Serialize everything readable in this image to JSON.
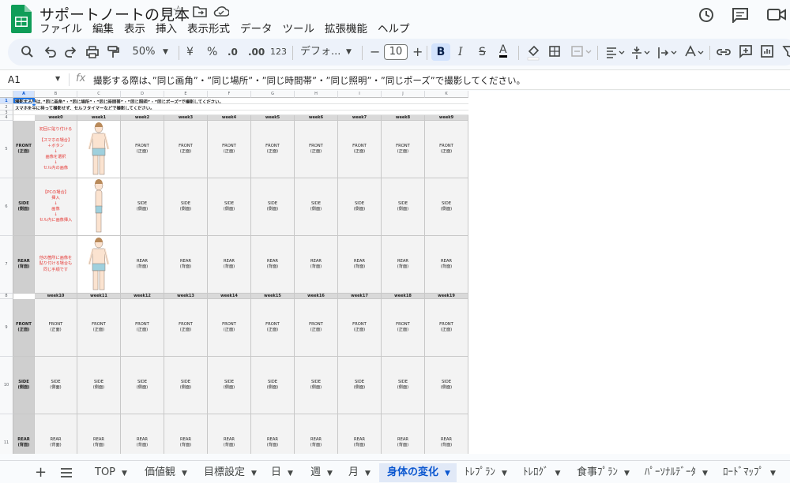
{
  "app": {
    "doc_title": "サポートノートの見本",
    "name_box": "A1",
    "formula": "撮影する際は、”同じ画角”・”同じ場所”・”同じ時間帯”・”同じ照明”・”同じポーズ”で撮影してください。"
  },
  "menu": [
    "ファイル",
    "編集",
    "表示",
    "挿入",
    "表示形式",
    "データ",
    "ツール",
    "拡張機能",
    "ヘルプ"
  ],
  "toolbar": {
    "zoom": "50%",
    "currency": "¥",
    "percent": "%",
    "dec_less": ".0",
    "dec_more": ".00",
    "format_123": "123",
    "font": "デフォ...",
    "font_size": "10",
    "minus": "−",
    "plus": "+",
    "bold": "B",
    "italic": "I",
    "strike": "S",
    "textcolor": "A"
  },
  "columns": [
    "A",
    "B",
    "C",
    "D",
    "E",
    "F",
    "G",
    "H",
    "I",
    "J",
    "K"
  ],
  "rows": {
    "r1": "1",
    "r2": "2",
    "r3": "3",
    "r4": "4",
    "r5": "5",
    "r6": "6",
    "r7": "7",
    "r8": "8",
    "r9": "9",
    "r10": "10",
    "r11": "11"
  },
  "notes": {
    "line1": "撮影する際は、”同じ画角”・”同じ場所”・”同じ時間帯”・”同じ照明”・”同じポーズ”で撮影してください。",
    "line2": "スマホを手に持って撮影せず、セルフタイマーなどで撮影してください。"
  },
  "weeks_top": [
    "week0",
    "week1",
    "week2",
    "week3",
    "week4",
    "week5",
    "week6",
    "week7",
    "week8",
    "week9"
  ],
  "weeks_bottom": [
    "week10",
    "week11",
    "week12",
    "week13",
    "week14",
    "week15",
    "week16",
    "week17",
    "week18",
    "week19"
  ],
  "row_labels": {
    "front": "FRONT\n(正面)",
    "side": "SIDE\n(側面)",
    "rear": "REAR\n(背面)"
  },
  "instructions": {
    "front": "初回に貼り付ける\n\n【スマホの場合】\n＋ボタン\n↓\n画像を選択\n↓\nセル内の画像",
    "side": "【PCの場合】\n挿入\n↓\n画像\n↓\nセル内に画像挿入",
    "rear": "他の箇所に画像を\n貼り付ける場合も\n同じ手順です"
  },
  "placeholders": {
    "front": "FRONT\n(正面)",
    "side": "SIDE\n(側面)",
    "rear": "REAR\n(背面)"
  },
  "tabs": [
    "TOP",
    "価値観",
    "目標設定",
    "日",
    "週",
    "月",
    "身体の変化",
    "ﾄﾚﾌﾟﾗﾝ",
    "ﾄﾚﾛｸﾞ",
    "食事ﾌﾟﾗﾝ",
    "ﾊﾟｰｿﾅﾙﾃﾞｰﾀ",
    "ﾛｰﾄﾞﾏｯﾌﾟ"
  ],
  "colors": {
    "sheets_green": "#0f9d58",
    "accent": "#0b57d0",
    "red_text": "#e53935"
  }
}
